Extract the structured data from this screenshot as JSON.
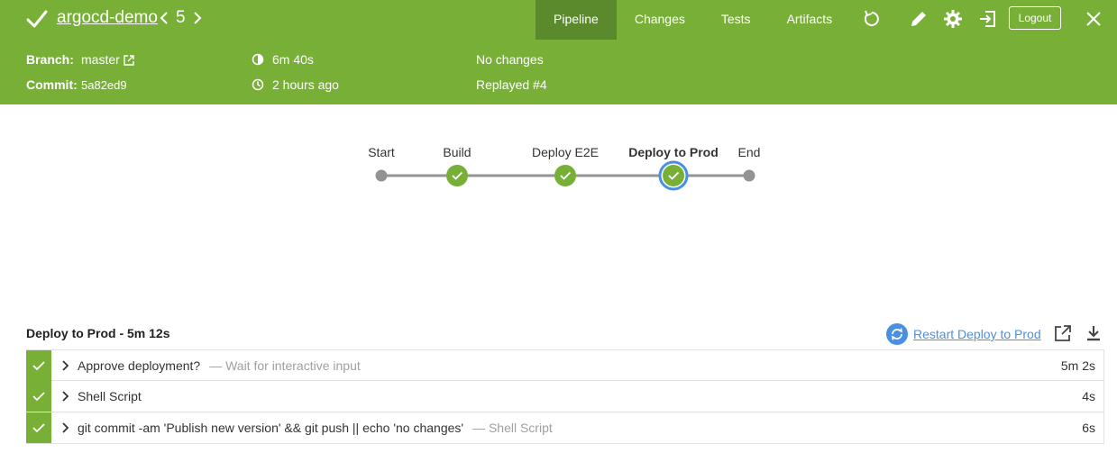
{
  "pipeline": {
    "name": "argocd-demo",
    "run_number": "5"
  },
  "tabs": [
    {
      "label": "Pipeline",
      "active": true
    },
    {
      "label": "Changes",
      "active": false
    },
    {
      "label": "Tests",
      "active": false
    },
    {
      "label": "Artifacts",
      "active": false
    }
  ],
  "toolbar": {
    "logout_label": "Logout"
  },
  "meta": {
    "branch_label": "Branch:",
    "branch_value": "master",
    "commit_label": "Commit:",
    "commit_value": "5a82ed9",
    "duration": "6m 40s",
    "time_ago": "2 hours ago",
    "changes": "No changes",
    "replayed": "Replayed #4"
  },
  "graph": {
    "stages": [
      {
        "label": "Start",
        "kind": "dot",
        "selected": false
      },
      {
        "label": "Build",
        "kind": "success",
        "selected": false
      },
      {
        "label": "Deploy E2E",
        "kind": "success",
        "selected": false
      },
      {
        "label": "Deploy to Prod",
        "kind": "success",
        "selected": true
      },
      {
        "label": "End",
        "kind": "dot",
        "selected": false
      }
    ]
  },
  "log": {
    "header": "Deploy to Prod - 5m 12s",
    "restart_label": "Restart Deploy to Prod",
    "steps": [
      {
        "title": "Approve deployment?",
        "desc": "— Wait for interactive input",
        "duration": "5m 2s"
      },
      {
        "title": "Shell Script",
        "desc": "",
        "duration": "4s"
      },
      {
        "title": "git commit -am 'Publish new version' && git push || echo 'no changes'",
        "desc": "— Shell Script",
        "duration": "6s"
      }
    ]
  },
  "colors": {
    "header_bg": "#78b037",
    "active_tab_bg": "#5a8a2b",
    "success": "#78b037",
    "selected_ring": "#4a90e2",
    "link": "#4a90e2"
  },
  "icons": {
    "status": "check-icon",
    "replay": "replay-icon",
    "edit": "pencil-icon",
    "settings": "gear-icon",
    "exit": "exit-icon",
    "close": "close-icon",
    "restart": "restart-icon",
    "open_external": "open-external-icon",
    "download": "download-icon"
  }
}
